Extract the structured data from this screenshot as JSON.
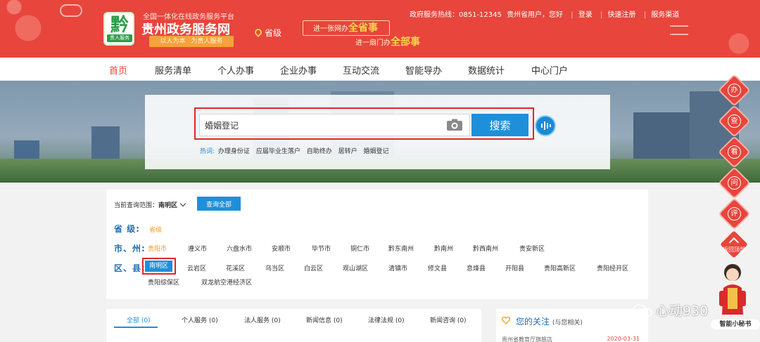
{
  "header": {
    "platform": "全国一体化在线政务服务平台",
    "title": "贵州政务服务网",
    "logo_glyph": "黔",
    "logo_tag": "贵人服务",
    "slogan_left": "以人为本",
    "slogan_right": "为贵人服务",
    "level": "省级",
    "banner1_prefix": "进一张网办",
    "banner1_highlight": "全省事",
    "banner2_prefix": "进一扇门办",
    "banner2_highlight": "全部事",
    "hotline": "政府服务热线：0851-12345",
    "greeting": "贵州省用户，您好",
    "login": "登录",
    "register": "快速注册",
    "channel": "服务渠道"
  },
  "nav": {
    "items": [
      "首页",
      "服务清单",
      "个人办事",
      "企业办事",
      "互动交流",
      "智能导办",
      "数据统计",
      "中心门户"
    ]
  },
  "search": {
    "value": "婚姻登记",
    "button": "搜索",
    "hot_label": "热词:",
    "hot_words": [
      "办理身份证",
      "应届毕业生落户",
      "自助终办",
      "居转户",
      "婚姻登记"
    ]
  },
  "region": {
    "scope_label": "当前查询范围：",
    "scope_value": "南明区",
    "query_all": "查询全部",
    "province_label": "省  级:",
    "province_items": [
      "省级"
    ],
    "city_label": "市、州:",
    "city_items": [
      "贵阳市",
      "遵义市",
      "六盘水市",
      "安顺市",
      "毕节市",
      "铜仁市",
      "黔东南州",
      "黔南州",
      "黔西南州",
      "贵安新区"
    ],
    "district_label": "区、县:",
    "district_selected": "南明区",
    "district_items": [
      "云岩区",
      "花溪区",
      "乌当区",
      "白云区",
      "观山湖区",
      "清镇市",
      "修文县",
      "息烽县",
      "开阳县",
      "贵阳高新区",
      "贵阳经开区"
    ],
    "district_items_row2": [
      "贵阳综保区",
      "双龙航空港经济区"
    ]
  },
  "tabs": {
    "items": [
      "全部 (0)",
      "个人服务 (0)",
      "法人服务 (0)",
      "新闻信息 (0)",
      "法律法规 (0)",
      "新闻咨询 (0)"
    ]
  },
  "follow": {
    "title": "您的关注",
    "subtitle": "(与您相关)",
    "item_text": "贵州省教育厅旗舰店",
    "item_date": "2020-03-31"
  },
  "float": {
    "items": [
      "办",
      "查",
      "看",
      "问",
      "评"
    ],
    "return_label": "返回顶部",
    "secretary": "智能小秘书"
  },
  "watermark": "心动930",
  "colors": {
    "header_red": "#e8453c",
    "primary_blue": "#1f8fd9",
    "highlight_red": "#e0262b",
    "accent_orange": "#f39a25"
  }
}
